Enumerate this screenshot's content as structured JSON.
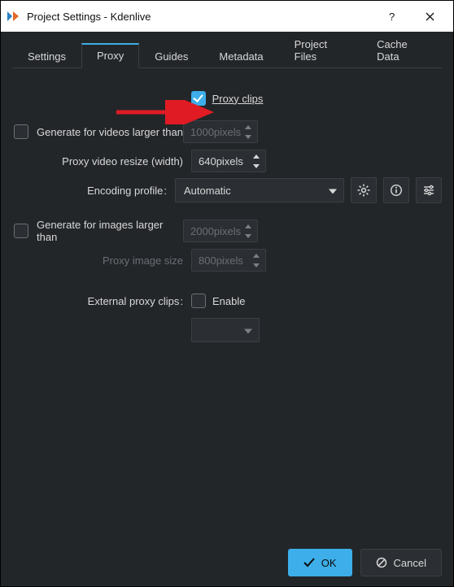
{
  "window": {
    "title": "Project Settings - Kdenlive"
  },
  "tabs": [
    {
      "label": "Settings"
    },
    {
      "label": "Proxy"
    },
    {
      "label": "Guides"
    },
    {
      "label": "Metadata"
    },
    {
      "label": "Project Files"
    },
    {
      "label": "Cache Data"
    }
  ],
  "active_tab_index": 1,
  "proxy": {
    "proxy_clips_label": "Proxy clips",
    "proxy_clips_checked": true,
    "gen_video_label": "Generate for videos larger than",
    "gen_video_checked": false,
    "gen_video_value": "1000pixels",
    "resize_label": "Proxy video resize (width)",
    "resize_value": "640pixels",
    "encoding_label": "Encoding profile",
    "encoding_value": "Automatic",
    "gen_image_label": "Generate for images larger than",
    "gen_image_checked": false,
    "gen_image_value": "2000pixels",
    "img_size_label": "Proxy image size",
    "img_size_value": "800pixels",
    "ext_label": "External proxy clips",
    "ext_enable_label": "Enable",
    "ext_enable_checked": false
  },
  "footer": {
    "ok": "OK",
    "cancel": "Cancel"
  },
  "icons": {
    "gear": "gear-icon",
    "info": "info-icon",
    "sliders": "sliders-icon"
  }
}
